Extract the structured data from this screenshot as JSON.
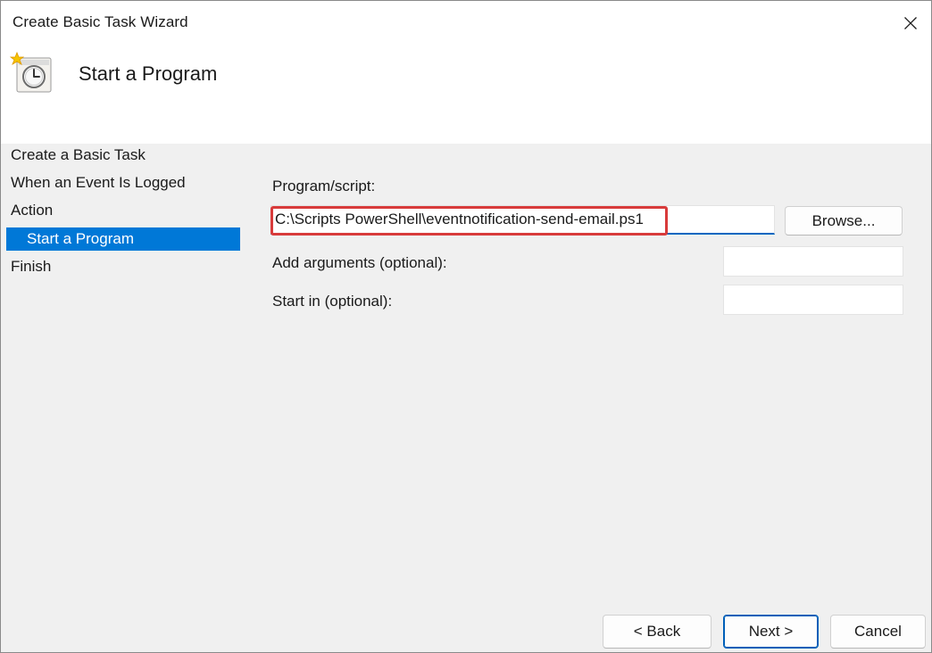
{
  "window": {
    "title": "Create Basic Task Wizard"
  },
  "header": {
    "title": "Start a Program",
    "icon": "task-scheduler-clock-icon"
  },
  "sidebar": {
    "items": [
      {
        "label": "Create a Basic Task",
        "selected": false
      },
      {
        "label": "When an Event Is Logged",
        "selected": false
      },
      {
        "label": "Action",
        "selected": false
      },
      {
        "label": "Start a Program",
        "selected": true
      },
      {
        "label": "Finish",
        "selected": false
      }
    ]
  },
  "form": {
    "program_label": "Program/script:",
    "program_value": "C:\\Scripts PowerShell\\eventnotification-send-email.ps1",
    "browse_label": "Browse...",
    "arguments_label": "Add arguments (optional):",
    "arguments_value": "",
    "startin_label": "Start in (optional):",
    "startin_value": ""
  },
  "footer": {
    "back_label": "< Back",
    "next_label": "Next >",
    "cancel_label": "Cancel"
  },
  "colors": {
    "selection": "#0078d7",
    "highlight": "#d83b3b",
    "focus_underline": "#0067c0"
  }
}
